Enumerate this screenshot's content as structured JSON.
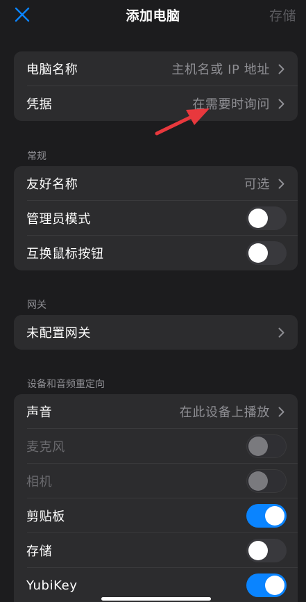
{
  "header": {
    "title": "添加电脑",
    "save_label": "存储",
    "close_icon": "close-icon"
  },
  "group1": {
    "rows": [
      {
        "label": "电脑名称",
        "value": "主机名或 IP 地址"
      },
      {
        "label": "凭据",
        "value": "在需要时询问"
      }
    ]
  },
  "general": {
    "header": "常规",
    "rows": [
      {
        "label": "友好名称",
        "value": "可选"
      },
      {
        "label": "管理员模式",
        "toggle": false
      },
      {
        "label": "互换鼠标按钮",
        "toggle": false
      }
    ]
  },
  "gateway": {
    "header": "网关",
    "rows": [
      {
        "label": "未配置网关"
      }
    ]
  },
  "redirect": {
    "header": "设备和音频重定向",
    "rows": [
      {
        "label": "声音",
        "value": "在此设备上播放"
      },
      {
        "label": "麦克风",
        "toggle": false,
        "disabled": true
      },
      {
        "label": "相机",
        "toggle": false,
        "disabled": true
      },
      {
        "label": "剪贴板",
        "toggle": true
      },
      {
        "label": "存储",
        "toggle": false
      },
      {
        "label": "YubiKey",
        "toggle": true
      }
    ]
  },
  "colors": {
    "accent": "#0a84ff",
    "annotation": "#e8383d"
  }
}
